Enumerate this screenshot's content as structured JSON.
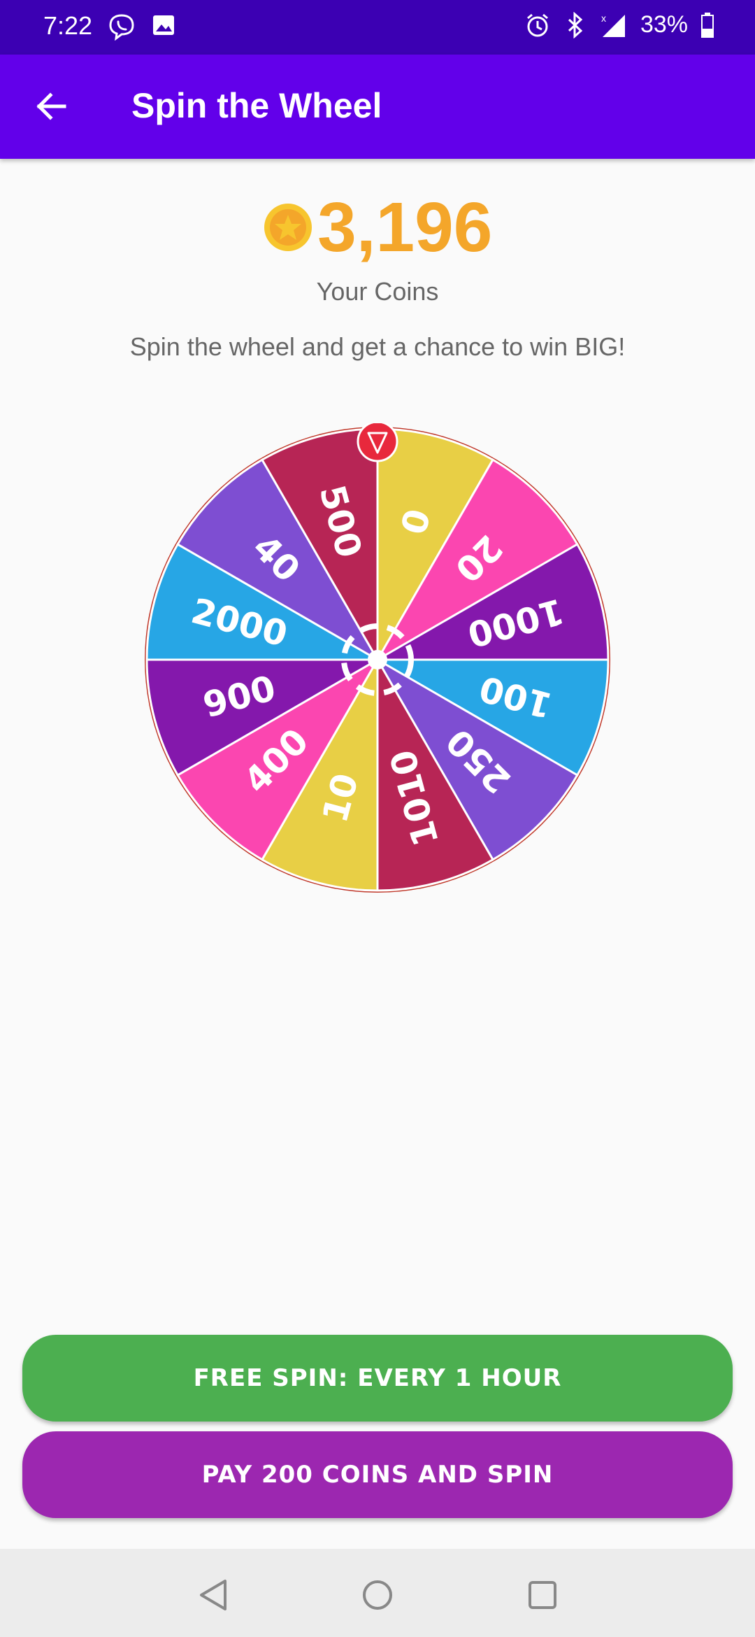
{
  "status_bar": {
    "time": "7:22",
    "battery": "33%",
    "left_icons": [
      "viber-icon",
      "image-icon"
    ],
    "right_icons": [
      "alarm-icon",
      "bluetooth-icon",
      "signal-icon",
      "battery-icon"
    ]
  },
  "app_bar": {
    "title": "Spin the Wheel",
    "back_icon": "arrow-left-icon",
    "color": "#6200ea"
  },
  "coins": {
    "value": "3,196",
    "label": "Your Coins",
    "color": "#f4a62a"
  },
  "subtitle": "Spin the wheel and get a chance to win BIG!",
  "wheel": {
    "pointer_color": "#e8283c",
    "segments": [
      {
        "label": "0",
        "color": "#e8cf45"
      },
      {
        "label": "20",
        "color": "#fb46b0"
      },
      {
        "label": "1000",
        "color": "#8418ac"
      },
      {
        "label": "100",
        "color": "#27a6e5"
      },
      {
        "label": "250",
        "color": "#7e4ed2"
      },
      {
        "label": "1010",
        "color": "#b72555"
      },
      {
        "label": "10",
        "color": "#e8cf45"
      },
      {
        "label": "400",
        "color": "#fb46b0"
      },
      {
        "label": "900",
        "color": "#8418ac"
      },
      {
        "label": "2000",
        "color": "#27a6e5"
      },
      {
        "label": "40",
        "color": "#7e4ed2"
      },
      {
        "label": "500",
        "color": "#b72555"
      }
    ]
  },
  "buttons": {
    "free_spin": "FREE SPIN: EVERY 1 HOUR",
    "pay_spin": "PAY 200 COINS AND SPIN",
    "free_color": "#4caf50",
    "pay_color": "#9c27b0"
  },
  "nav": {
    "icons": [
      "back-triangle-icon",
      "home-circle-icon",
      "recents-square-icon"
    ]
  }
}
